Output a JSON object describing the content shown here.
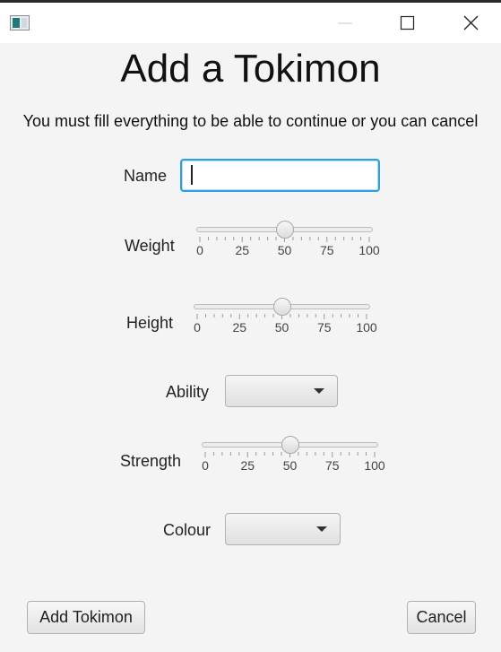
{
  "window": {
    "icons": {
      "app": "app-icon",
      "minimize": "minimize-icon",
      "maximize": "maximize-icon",
      "close": "close-icon"
    }
  },
  "header": {
    "title": "Add a Tokimon",
    "subtitle": "You must fill everything to be able to continue or you can cancel"
  },
  "form": {
    "name": {
      "label": "Name",
      "value": "",
      "placeholder": ""
    },
    "weight": {
      "label": "Weight",
      "value": 50,
      "ticks": [
        "0",
        "25",
        "50",
        "75",
        "100"
      ]
    },
    "height": {
      "label": "Height",
      "value": 50,
      "ticks": [
        "0",
        "25",
        "50",
        "75",
        "100"
      ]
    },
    "ability": {
      "label": "Ability",
      "selected": ""
    },
    "strength": {
      "label": "Strength",
      "value": 50,
      "ticks": [
        "0",
        "25",
        "50",
        "75",
        "100"
      ]
    },
    "colour": {
      "label": "Colour",
      "selected": ""
    }
  },
  "actions": {
    "add_label": "Add Tokimon",
    "cancel_label": "Cancel"
  },
  "colors": {
    "focus": "#2aa0e0",
    "background": "#f4f4f4"
  }
}
